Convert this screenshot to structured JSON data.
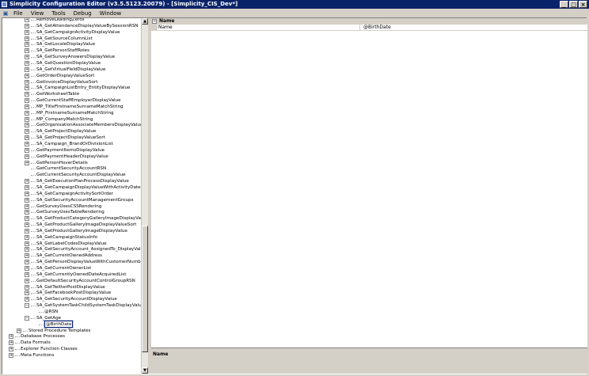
{
  "window": {
    "title": "Simplicity Configuration Editor (v3.5.5123.20079) - [Simplicity_CIS_Dev*]",
    "controls": [
      "_",
      "□",
      "×"
    ]
  },
  "menu": [
    "File",
    "View",
    "Tools",
    "Debug",
    "Window"
  ],
  "tree": {
    "items": [
      {
        "label": "RemoveLeadingZeros",
        "expander": "+"
      },
      {
        "label": "SA_GetAttendanceDisplayValueBySessionRSN",
        "expander": "+"
      },
      {
        "label": "SA_GetCampaignActivityDisplayValue",
        "expander": "+"
      },
      {
        "label": "SA_GetSourceColumnList",
        "expander": "+"
      },
      {
        "label": "SA_GetLocaleDisplayValue",
        "expander": "+"
      },
      {
        "label": "SA_GetPersonStaffRoles",
        "expander": "+"
      },
      {
        "label": "SA_GetSurveyAnswersDisplayValue",
        "expander": "+"
      },
      {
        "label": "SA_GetQuestionDisplayValue",
        "expander": "+"
      },
      {
        "label": "SA_GetVirtualFieldDisplayValue",
        "expander": "+"
      },
      {
        "label": "GetOrderDisplayValueSort",
        "expander": "+"
      },
      {
        "label": "GetInvoiceDisplayValueSort",
        "expander": "+"
      },
      {
        "label": "SA_CampaignListEntry_EntityDisplayValue",
        "expander": "+"
      },
      {
        "label": "GetWorksheetTable",
        "expander": "+"
      },
      {
        "label": "GetCurrentStaffEmployerDisplayValue",
        "expander": "+"
      },
      {
        "label": "MP_TitleFirstnameSurnameMatchString",
        "expander": "+"
      },
      {
        "label": "MP_FirstnameSurnameMatchString",
        "expander": "+"
      },
      {
        "label": "MP_CompanyMatchString",
        "expander": "+"
      },
      {
        "label": "GetOrganisationAssociateMembersDisplayValue",
        "expander": "+"
      },
      {
        "label": "SA_GetProjectDisplayValue",
        "expander": "+"
      },
      {
        "label": "SA_GetProjectDisplayValueSort",
        "expander": "+"
      },
      {
        "label": "SA_Campaign_BrandOrDivisionList",
        "expander": "+"
      },
      {
        "label": "GetPaymentItemsDisplayValue",
        "expander": "+"
      },
      {
        "label": "GetPaymentHeaderDisplayValue",
        "expander": "+"
      },
      {
        "label": "GetPersonHoverDetails",
        "expander": "+"
      },
      {
        "label": "GetCurrentSecurityAccountRSN",
        "expander": ""
      },
      {
        "label": "GetCurrentSecurityAccountDisplayValue",
        "expander": ""
      },
      {
        "label": "SA_GetExecutionPlanProcessDisplayValue",
        "expander": "+"
      },
      {
        "label": "SA_GetCampaignDisplayValueWithActivityDateRange",
        "expander": "+"
      },
      {
        "label": "SA_GetCampaignActivitySortOrder",
        "expander": "+"
      },
      {
        "label": "SA_GetSecurityAccountManagementGroups",
        "expander": "+"
      },
      {
        "label": "GetSurveyUsesCSSRendering",
        "expander": "+"
      },
      {
        "label": "GetSurveyUsesTableRendering",
        "expander": "+"
      },
      {
        "label": "SA_GetProductCategoryGalleryImageDisplayValueSort",
        "expander": "+"
      },
      {
        "label": "SA_GetProductGalleryImageDisplayValueSort",
        "expander": "+"
      },
      {
        "label": "SA_GetProductGalleryImageDisplayValue",
        "expander": "+"
      },
      {
        "label": "SA_GetCampaignStatusInfo",
        "expander": "+"
      },
      {
        "label": "SA_GetLabelCodesDisplayValue",
        "expander": "+"
      },
      {
        "label": "SA_GetSecurityAccount_AssignedTo_DisplayValue",
        "expander": "+"
      },
      {
        "label": "SA_GetCurrentOwnedAddress",
        "expander": "+"
      },
      {
        "label": "SA_GetPersonDisplayValueWithCustomerNumber",
        "expander": "+"
      },
      {
        "label": "SA_GetCurrentOwnerList",
        "expander": "+"
      },
      {
        "label": "SA_GetCurrentlyOwnedDateAcquiredList",
        "expander": "+"
      },
      {
        "label": "GetDefaultSecurityAccountControlGroupRSN",
        "expander": "+"
      },
      {
        "label": "SA_GetTwitterPostDisplayValue",
        "expander": "+"
      },
      {
        "label": "SA_GetFacebookPostDisplayValue",
        "expander": "+"
      },
      {
        "label": "SA_GetSecurityAccountDisplayValue",
        "expander": "+"
      },
      {
        "label": "SA_GetSystemTaskChildSystemTaskDisplayValue",
        "expander": "-"
      },
      {
        "label": "@RSN",
        "expander": "",
        "indent": 1
      },
      {
        "label": "SA_GetAge",
        "expander": "-"
      },
      {
        "label": "@BirthDate",
        "expander": "",
        "indent": 1,
        "selected": true
      }
    ],
    "stored_procedures": {
      "label": "Stored Procedure Templates",
      "expander": "+"
    },
    "root_items": [
      {
        "label": "Database Processes",
        "expander": "+"
      },
      {
        "label": "Data Formats",
        "expander": "+"
      },
      {
        "label": "Explorer Function Classes",
        "expander": "+"
      },
      {
        "label": "Meta Functions",
        "expander": "+"
      }
    ]
  },
  "property_grid": {
    "category": "Name",
    "rows": [
      {
        "name": "Name",
        "value": "@BirthDate"
      }
    ],
    "description_title": "Name"
  }
}
